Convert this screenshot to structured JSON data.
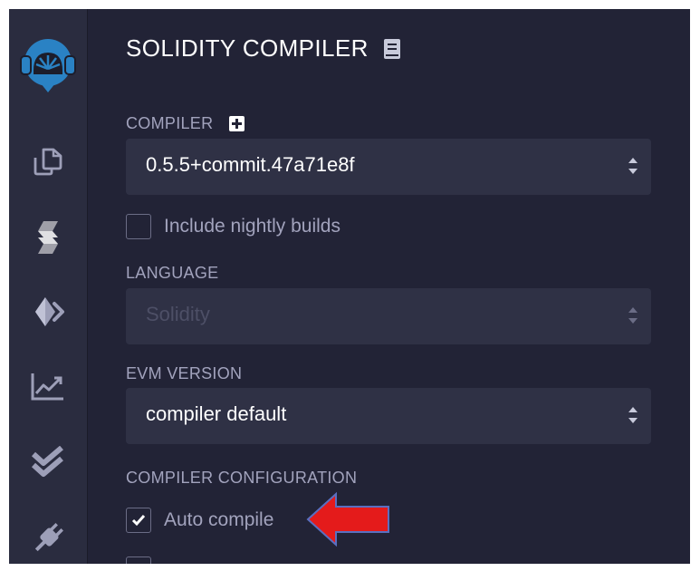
{
  "panel": {
    "title": "SOLIDITY COMPILER"
  },
  "compiler": {
    "label": "COMPILER",
    "version": "0.5.5+commit.47a71e8f",
    "nightly_label": "Include nightly builds",
    "nightly_checked": false
  },
  "language": {
    "label": "LANGUAGE",
    "value": "Solidity",
    "disabled": true
  },
  "evm": {
    "label": "EVM VERSION",
    "value": "compiler default"
  },
  "config": {
    "label": "COMPILER CONFIGURATION",
    "auto_compile_label": "Auto compile",
    "auto_compile_checked": true
  },
  "sidebar": {
    "icons": [
      "remix-logo-icon",
      "file-explorer-icon",
      "solidity-compiler-icon",
      "deploy-run-icon",
      "analysis-icon",
      "testing-icon",
      "plugin-manager-icon"
    ]
  },
  "colors": {
    "background": "#222336",
    "sidebar": "#2a2c3f",
    "select": "#2f3145",
    "accent": "#2a82c4",
    "annotation_arrow": "#e41b1b"
  }
}
